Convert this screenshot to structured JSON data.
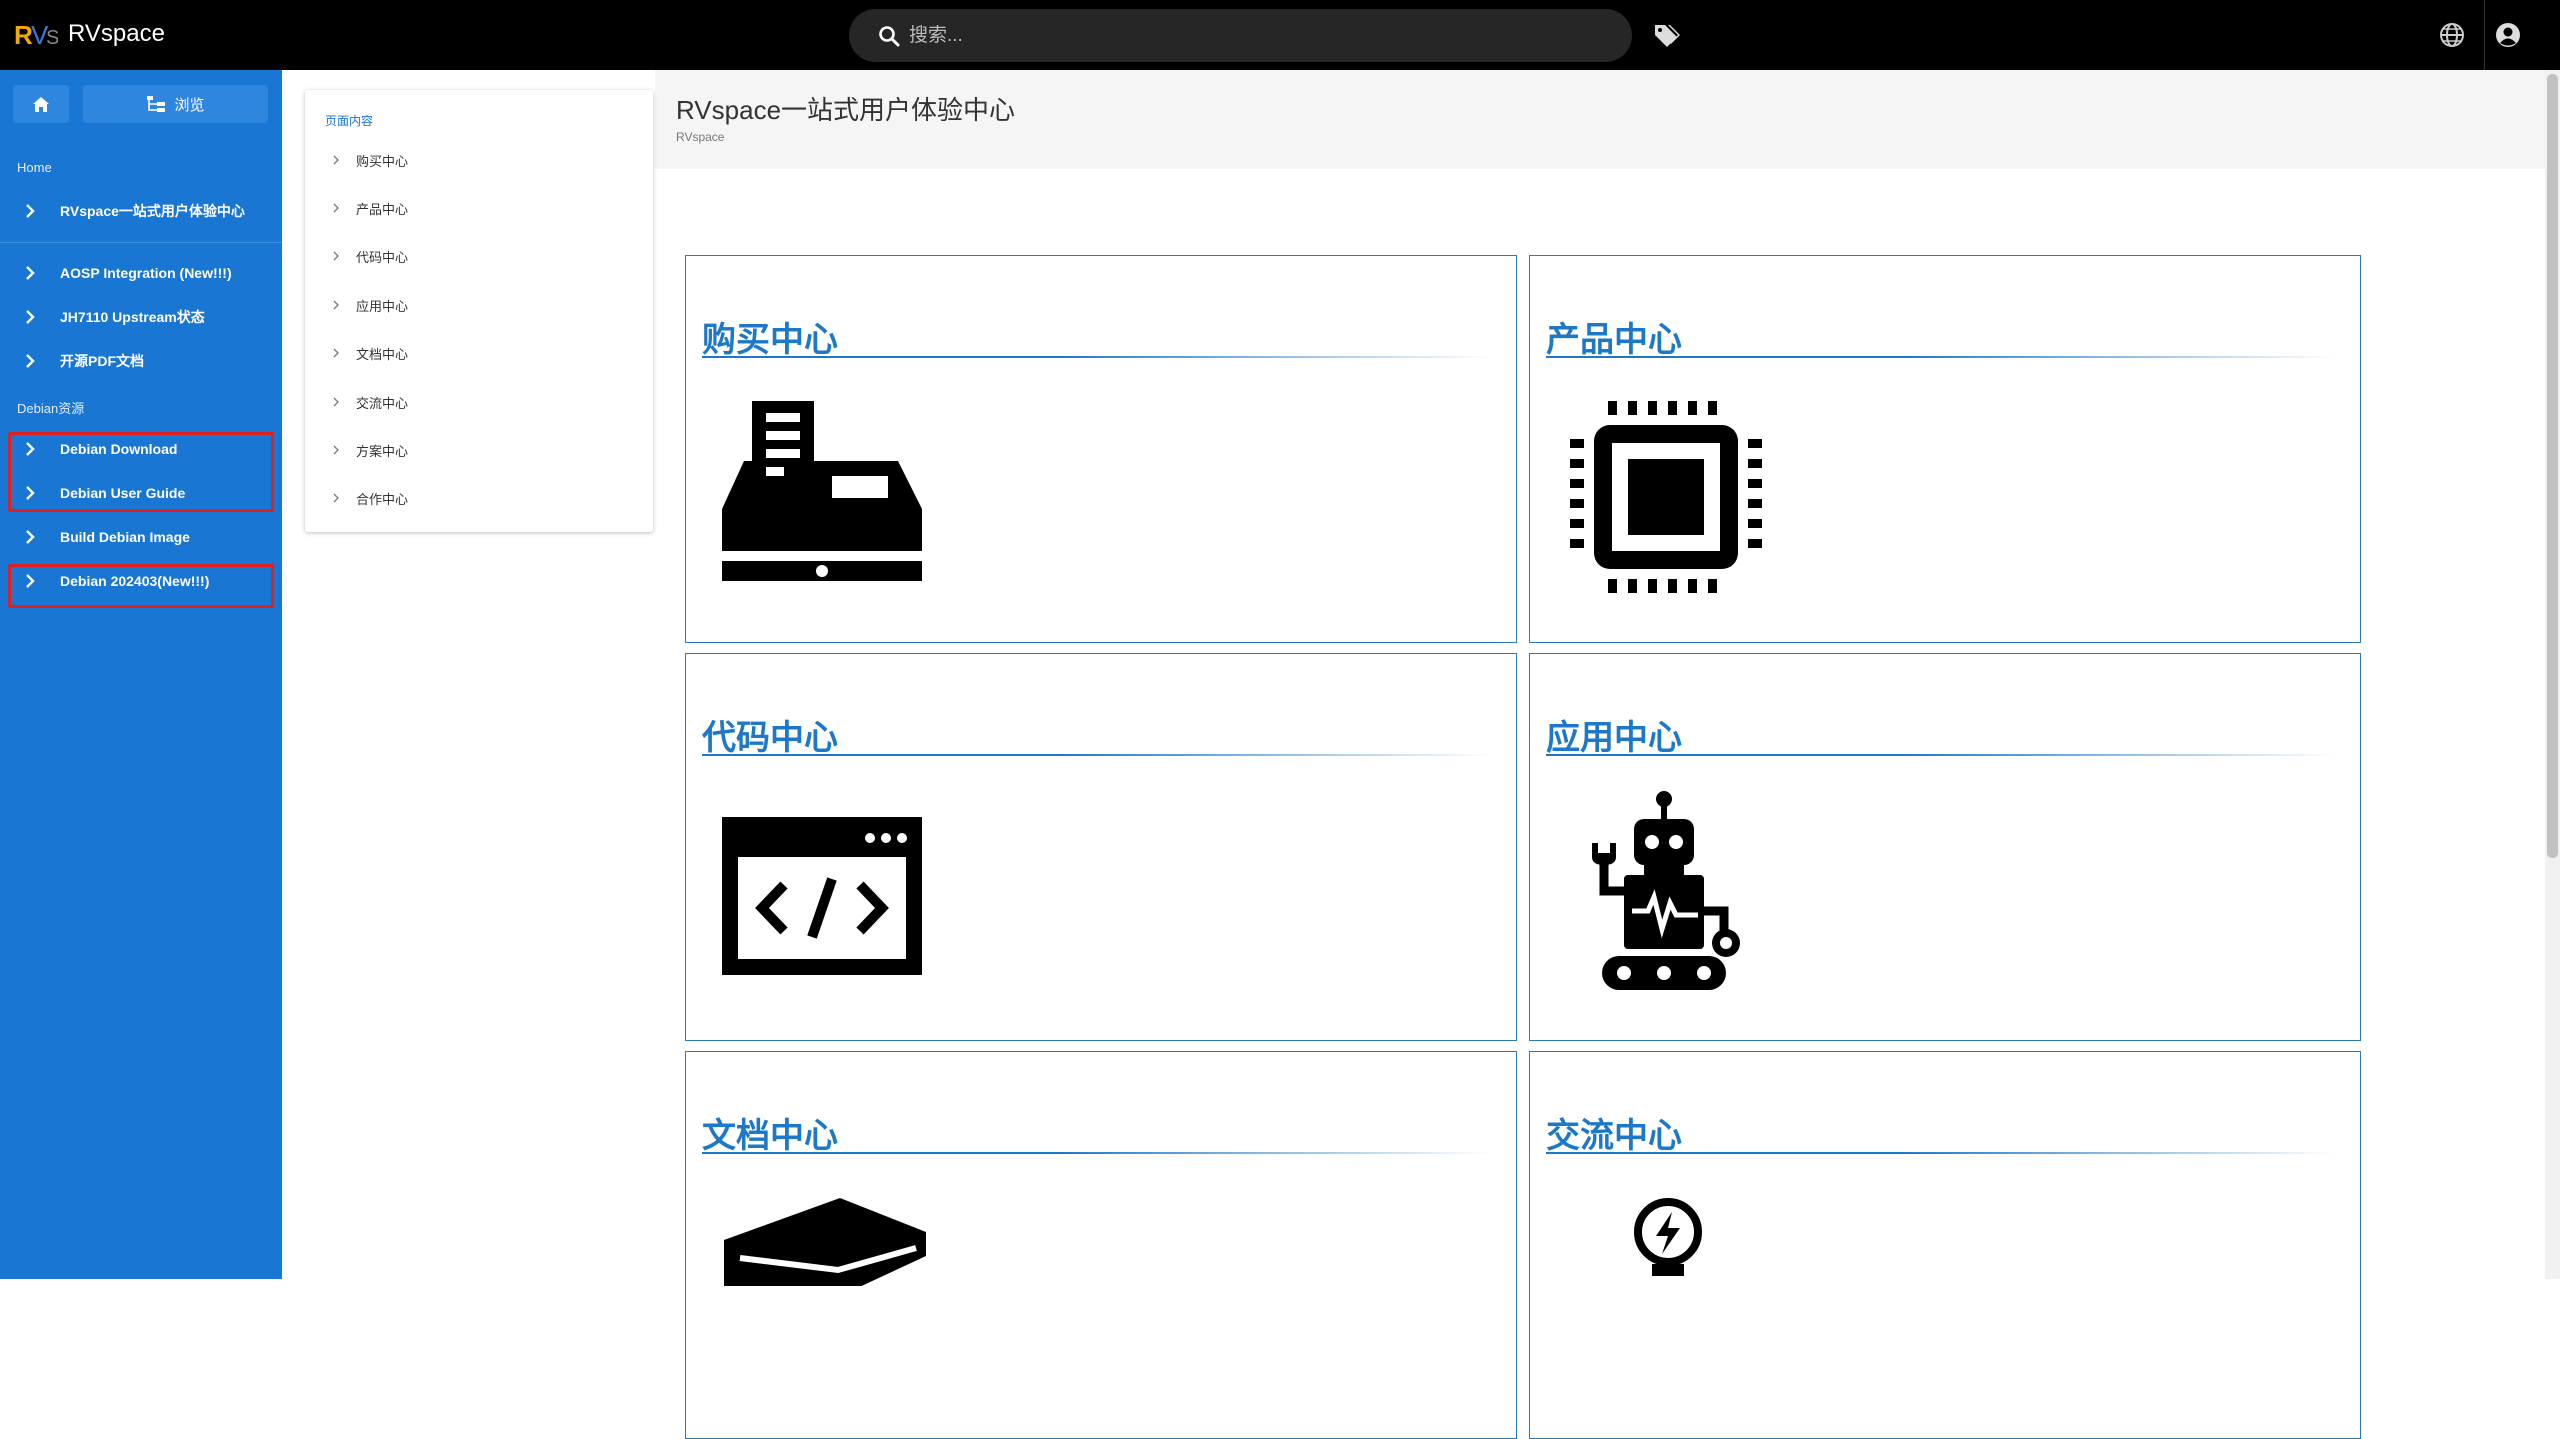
{
  "topbar": {
    "app_title": "RVspace",
    "search_placeholder": "搜索..."
  },
  "sidebar": {
    "browse_label": "浏览",
    "section_home": "Home",
    "section_debian": "Debian资源",
    "items": [
      {
        "label": "RVspace一站式用户体验中心"
      },
      {
        "label": "AOSP Integration (New!!!)"
      },
      {
        "label": "JH7110 Upstream状态"
      },
      {
        "label": "开源PDF文档"
      },
      {
        "label": "Debian Download"
      },
      {
        "label": "Debian User Guide"
      },
      {
        "label": "Build Debian Image"
      },
      {
        "label": "Debian 202403(New!!!)"
      }
    ]
  },
  "toc": {
    "title": "页面内容",
    "items": [
      "购买中心",
      "产品中心",
      "代码中心",
      "应用中心",
      "文档中心",
      "交流中心",
      "方案中心",
      "合作中心"
    ]
  },
  "page": {
    "title": "RVspace一站式用户体验中心",
    "breadcrumb": "RVspace"
  },
  "cards": [
    {
      "title": "购买中心",
      "icon": "cash-register-icon"
    },
    {
      "title": "产品中心",
      "icon": "microchip-icon"
    },
    {
      "title": "代码中心",
      "icon": "code-window-icon"
    },
    {
      "title": "应用中心",
      "icon": "robot-icon"
    },
    {
      "title": "文档中心",
      "icon": "book-icon"
    },
    {
      "title": "交流中心",
      "icon": "lightbulb-icon"
    }
  ],
  "colors": {
    "topbar": "#000000",
    "sidebar": "#1976d2",
    "accent": "#1e78c8",
    "highlight": "#e02020"
  }
}
